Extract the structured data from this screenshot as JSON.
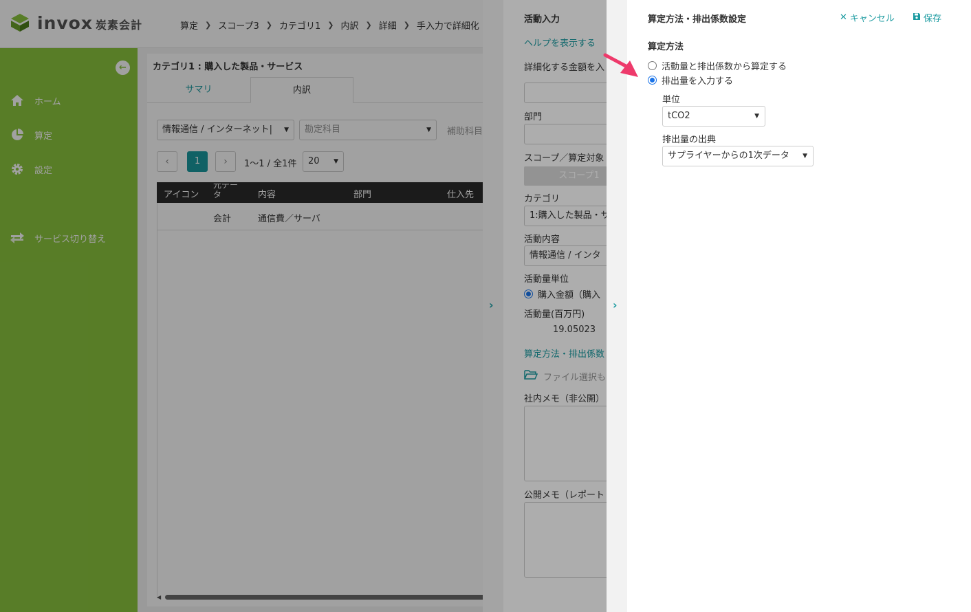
{
  "app": {
    "logo_text": "invox",
    "logo_sub": "炭素会計",
    "brand_color": "#8cc63f",
    "accent_color": "#1a9aa0"
  },
  "breadcrumb": [
    "算定",
    "スコープ3",
    "カテゴリ1",
    "内訳",
    "詳細",
    "手入力で詳細化"
  ],
  "sidebar": {
    "items": [
      {
        "label": "ホーム",
        "icon": "home-icon"
      },
      {
        "label": "算定",
        "icon": "pie-chart-icon"
      },
      {
        "label": "設定",
        "icon": "gear-icon"
      },
      {
        "label": "サービス切り替え",
        "icon": "switch-icon"
      }
    ]
  },
  "panel": {
    "title": "カテゴリ1 : 購入した製品・サービス",
    "tabs": [
      {
        "label": "サマリ"
      },
      {
        "label": "内訳"
      }
    ],
    "filter_category": "情報通信 / インターネット|",
    "filter_account_placeholder": "勘定科目",
    "filter_sub_label": "補助科目",
    "pager": {
      "current": "1",
      "summary": "1〜1 / 全1件",
      "per_page": "20"
    },
    "table": {
      "headers": [
        "アイコン",
        "元データ",
        "内容",
        "部門",
        "仕入先"
      ],
      "rows": [
        {
          "source": "会計",
          "content": "通信費／サーバ"
        }
      ]
    }
  },
  "activity_drawer": {
    "title": "活動入力",
    "help_link": "ヘルプを表示する",
    "detail_amount_label": "詳細化する金額を入",
    "department_label": "部門",
    "scope_label": "スコープ／算定対象",
    "scope_button": "スコープ1",
    "category_label": "カテゴリ",
    "category_value": "1:購入した製品・サ",
    "activity_label": "活動内容",
    "activity_value": "情報通信 / インタ",
    "unit_label": "活動量単位",
    "unit_option": "購入金額（購入",
    "amount_label": "活動量(百万円)",
    "amount_value": "19.05023",
    "method_link": "算定方法・排出係数",
    "file_select": "ファイル選択も",
    "internal_memo_label": "社内メモ（非公開）",
    "public_memo_label": "公開メモ（レポート"
  },
  "method_drawer": {
    "title": "算定方法・排出係数設定",
    "cancel_label": "キャンセル",
    "save_label": "保存",
    "section_label": "算定方法",
    "options": [
      {
        "label": "活動量と排出係数から算定する",
        "checked": false
      },
      {
        "label": "排出量を入力する",
        "checked": true
      }
    ],
    "unit_label": "単位",
    "unit_value": "tCO2",
    "source_label": "排出量の出典",
    "source_value": "サプライヤーからの1次データ"
  },
  "annotation": {
    "arrow_color": "#ee3a6b"
  }
}
